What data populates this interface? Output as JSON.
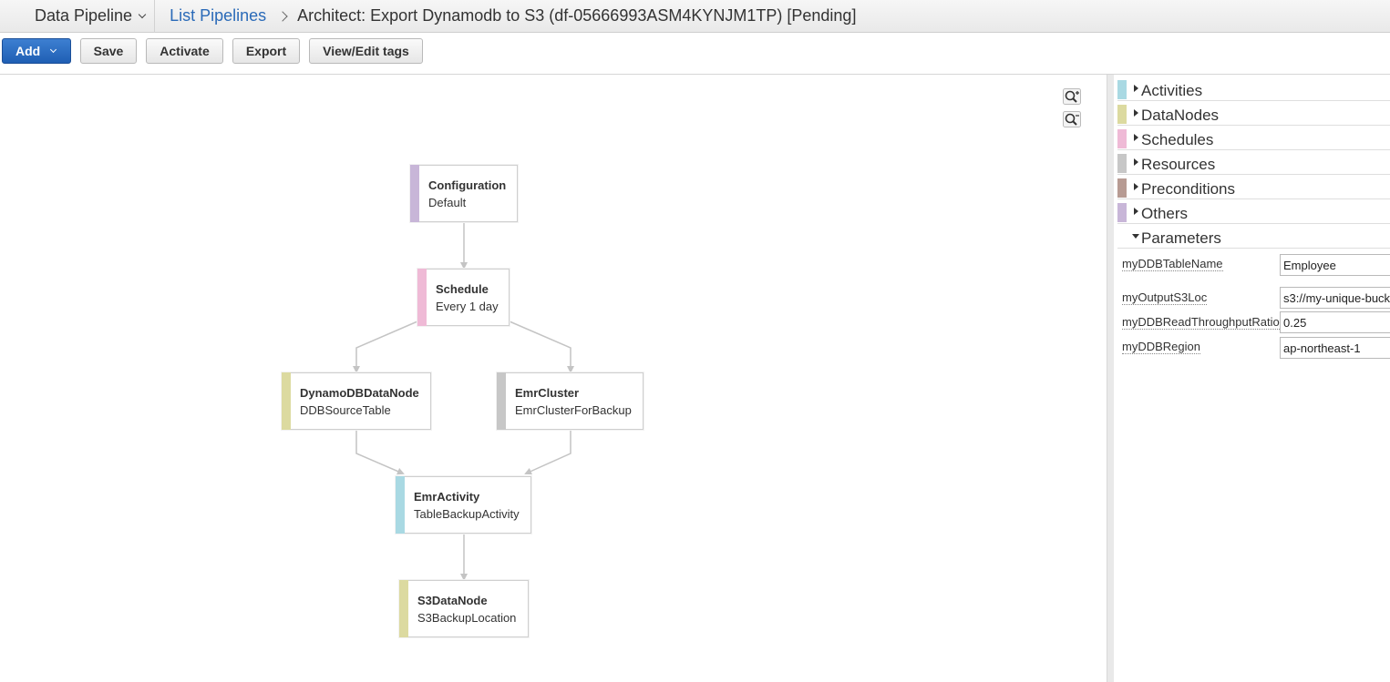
{
  "header": {
    "service": "Data Pipeline",
    "breadcrumb_link": "List Pipelines",
    "page_title": "Architect: Export Dynamodb to S3 (df-05666993ASM4KYNJM1TP) [Pending]"
  },
  "toolbar": {
    "add": "Add",
    "save": "Save",
    "activate": "Activate",
    "export": "Export",
    "tags": "View/Edit tags"
  },
  "colors": {
    "activities": "#a9d9e3",
    "datanodes": "#dcdaa0",
    "schedules": "#efbad6",
    "resources": "#c7c7c7",
    "preconditions": "#b79b93",
    "others": "#c8b6d8",
    "edge": "#c4c4c4"
  },
  "graph": {
    "nodes": [
      {
        "id": "configuration",
        "type": "Configuration",
        "name": "Default",
        "color": "#c8b6d8"
      },
      {
        "id": "schedule",
        "type": "Schedule",
        "name": "Every 1 day",
        "color": "#efbad6"
      },
      {
        "id": "dynamo",
        "type": "DynamoDBDataNode",
        "name": "DDBSourceTable",
        "color": "#dcdaa0"
      },
      {
        "id": "emrcluster",
        "type": "EmrCluster",
        "name": "EmrClusterForBackup",
        "color": "#c7c7c7"
      },
      {
        "id": "emractivity",
        "type": "EmrActivity",
        "name": "TableBackupActivity",
        "color": "#a9d9e3"
      },
      {
        "id": "s3node",
        "type": "S3DataNode",
        "name": "S3BackupLocation",
        "color": "#dcdaa0"
      }
    ]
  },
  "panel": {
    "sections": [
      {
        "label": "Activities",
        "icon": "collapsed-triangle-icon"
      },
      {
        "label": "DataNodes",
        "icon": "collapsed-triangle-icon"
      },
      {
        "label": "Schedules",
        "icon": "collapsed-triangle-icon"
      },
      {
        "label": "Resources",
        "icon": "collapsed-triangle-icon"
      },
      {
        "label": "Preconditions",
        "icon": "collapsed-triangle-icon"
      },
      {
        "label": "Others",
        "icon": "collapsed-triangle-icon"
      },
      {
        "label": "Parameters",
        "icon": "expanded-triangle-icon"
      }
    ],
    "parameters": [
      {
        "name": "myDDBTableName",
        "value": "Employee"
      },
      {
        "name": "myOutputS3Loc",
        "value": "s3://my-unique-buck"
      },
      {
        "name": "myDDBReadThroughputRatio",
        "value": "0.25"
      },
      {
        "name": "myDDBRegion",
        "value": "ap-northeast-1"
      }
    ]
  }
}
